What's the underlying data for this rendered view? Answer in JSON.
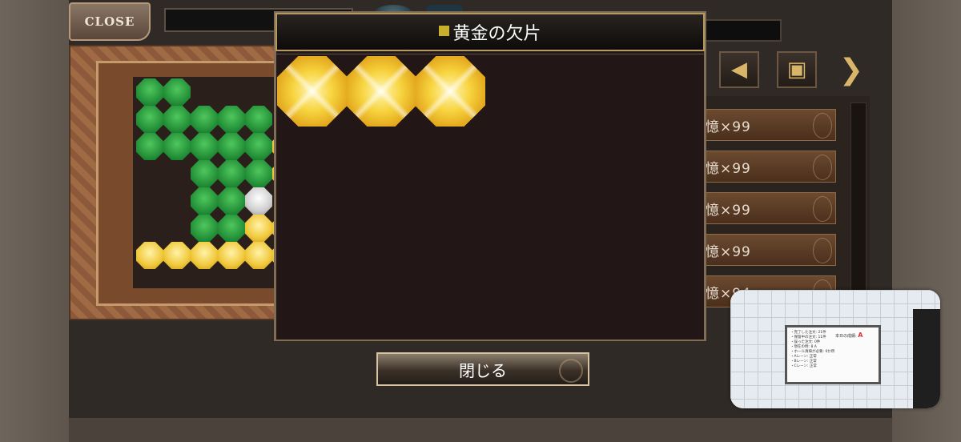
{
  "close_button": "CLOSE",
  "modal": {
    "title": "黄金の欠片",
    "close_label": "閉じる",
    "items": [
      {
        "icon": "gold-fragment-icon"
      },
      {
        "icon": "gold-fragment-icon"
      },
      {
        "icon": "gold-fragment-icon"
      }
    ]
  },
  "list_items": [
    {
      "label": "憶×99"
    },
    {
      "label": "憶×99"
    },
    {
      "label": "憶×99"
    },
    {
      "label": "憶×99"
    },
    {
      "label": "憶×94"
    }
  ],
  "camera_overlay": {
    "grade_label": "本日の成績:",
    "grade_value": "A",
    "lines": [
      "・完了した注文: 21件",
      "・保留中の注文: 11件",
      "・誤った注文: 0件",
      "・現在の時: 8 A",
      "・ホール清掃が必要: 0か所",
      "・Aレーン: 正常",
      "・Bレーン: 正常",
      "・Cレーン: 正常"
    ]
  },
  "colors": {
    "accent_gold": "#c8b02a",
    "gem_gold": "#f7d43f",
    "gem_green": "#2faa48",
    "grade_red": "#e03333"
  }
}
